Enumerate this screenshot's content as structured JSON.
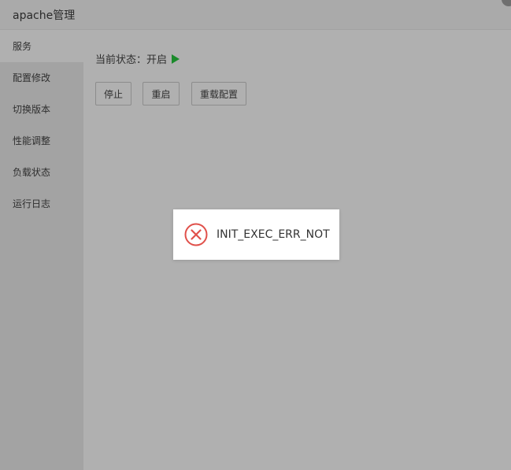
{
  "window": {
    "title": "apache管理"
  },
  "sidebar": {
    "items": [
      {
        "label": "服务",
        "active": true
      },
      {
        "label": "配置修改",
        "active": false
      },
      {
        "label": "切换版本",
        "active": false
      },
      {
        "label": "性能调整",
        "active": false
      },
      {
        "label": "负载状态",
        "active": false
      },
      {
        "label": "运行日志",
        "active": false
      }
    ]
  },
  "service": {
    "status_label": "当前状态：",
    "status_value": "开启",
    "status_icon": "play-icon",
    "status_color": "#1b8a2b",
    "buttons": {
      "stop": "停止",
      "restart": "重启",
      "reload": "重载配置"
    }
  },
  "message": {
    "icon": "error-circle-icon",
    "icon_color": "#e0504a",
    "text": "INIT_EXEC_ERR_NOT"
  }
}
